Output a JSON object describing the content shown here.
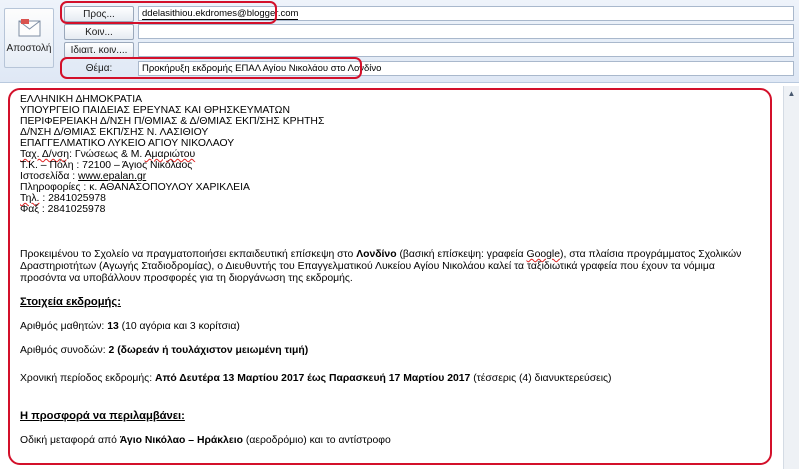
{
  "header": {
    "send_label": "Αποστολή",
    "to_button": "Προς...",
    "to_value": "ddelasithiou.ekdromes@blogger.com",
    "cc_button": "Κοιν...",
    "cc_value": "",
    "bcc_button": "Ιδιαιτ. κοιν....",
    "bcc_value": "",
    "subject_label": "Θέμα:",
    "subject_value": "Προκήρυξη εκδρομής ΕΠΑΛ Αγίου Νικολάου στο Λονδίνο"
  },
  "body": {
    "letterhead": [
      "ΕΛΛΗΝΙΚΗ  ΔΗΜΟΚΡΑΤΙΑ",
      "ΥΠΟΥΡΓΕΙΟ ΠΑΙΔΕΙΑΣ ΕΡΕΥΝΑΣ ΚΑΙ ΘΡΗΣΚΕΥΜΑΤΩΝ",
      "ΠΕΡΙΦΕΡΕΙΑΚΗ Δ/ΝΣΗ Π/ΘΜΙΑΣ & Δ/ΘΜΙΑΣ ΕΚΠ/ΣΗΣ  ΚΡΗΤΗΣ",
      "Δ/ΝΣΗ Δ/ΘΜΙΑΣ ΕΚΠ/ΣΗΣ Ν. ΛΑΣΙΘΙΟΥ",
      "ΕΠΑΓΓΕΛΜΑΤΙΚΟ ΛΥΚΕΙΟ ΑΓΙΟΥ ΝΙΚΟΛΑΟΥ"
    ],
    "address_prefix": "Ταχ. Δ/νση",
    "address_mid": ": Γνώσεως & Μ. ",
    "address_name": "Αμαριώτου",
    "postal": "Τ.Κ. – Πόλη :  72100 – Άγιος Νικόλαος",
    "website_label": "Ιστοσελίδα :  ",
    "website": "www.epalan.gr",
    "info": "Πληροφορίες : κ. ΑΘΑΝΑΣΟΠΟΥΛΟΥ ΧΑΡΙΚΛΕΙΑ",
    "tel_label": "Τηλ.",
    "tel_value": " : 2841025978",
    "fax": "Φαξ : 2841025978",
    "intro_1": "Προκειμένου το Σχολείο να πραγματοποιήσει εκπαιδευτική επίσκεψη στο ",
    "intro_city": "Λονδίνο",
    "intro_2": " (βασική επίσκεψη: γραφεία ",
    "intro_google": "Google",
    "intro_3": "), στα πλαίσια προγράμματος Σχολικών Δραστηριοτήτων (Αγωγής Σταδιοδρομίας), ο Διευθυντής του Επαγγελματικού Λυκείου Αγίου Νικολάου καλεί τα ταξιδιωτικά γραφεία που έχουν τα νόμιμα προσόντα να υποβάλλουν προσφορές για τη διοργάνωση της εκδρομής.",
    "section1_title": "Στοιχεία εκδρομής:",
    "students_label": "Αριθμός μαθητών: ",
    "students_count": "13",
    "students_detail": " (10 αγόρια και 3 κορίτσια)",
    "escorts_label": "Αριθμός συνοδών: ",
    "escorts_value": "2 (δωρεάν ή τουλάχιστον μειωμένη τιμή)",
    "period_label": "Χρονική περίοδος εκδρομής: ",
    "period_value": "Από Δευτέρα 13 Μαρτίου 2017 έως Παρασκευή 17 Μαρτίου 2017",
    "period_detail": " (τέσσερις (4) διανυκτερεύσεις)",
    "section2_title": "Η προσφορά να περιλαμβάνει:",
    "transport_label": "Οδική μεταφορά από ",
    "transport_route": "Άγιο Νικόλαο – Ηράκλειο",
    "transport_detail": " (αεροδρόμιο) και το αντίστροφο"
  }
}
